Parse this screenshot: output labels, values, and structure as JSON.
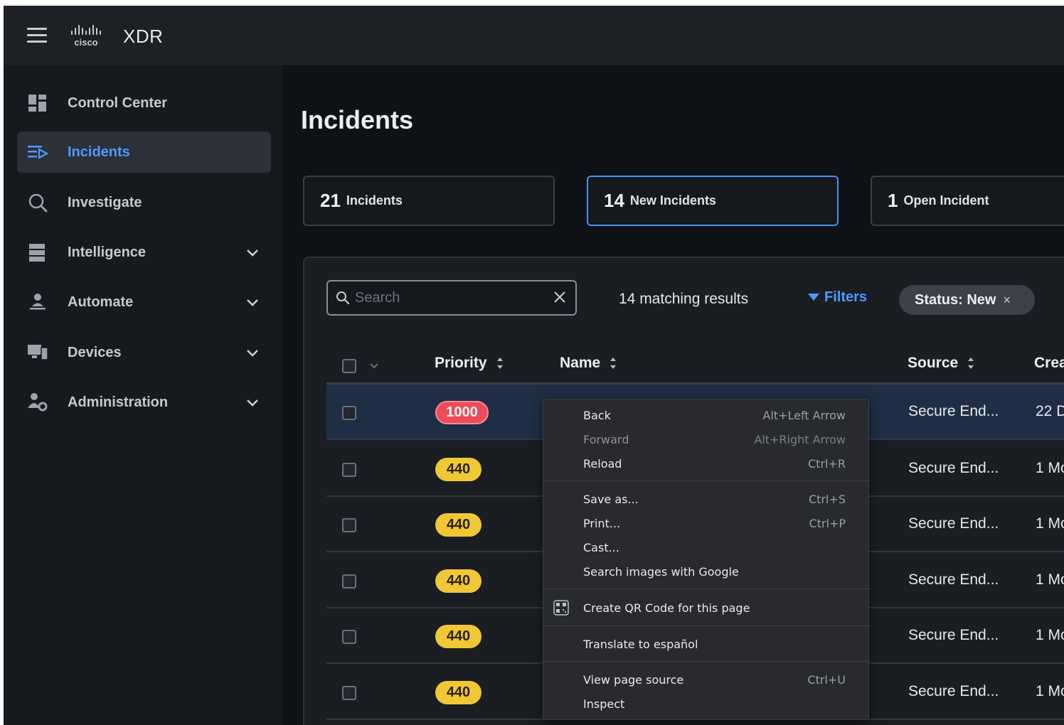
{
  "app": {
    "title": "XDR",
    "logo_text": "cisco"
  },
  "sidebar": {
    "items": [
      {
        "label": "Control Center",
        "icon": "dashboard-icon",
        "expandable": false,
        "active": false
      },
      {
        "label": "Incidents",
        "icon": "incidents-icon",
        "expandable": false,
        "active": true
      },
      {
        "label": "Investigate",
        "icon": "search-icon",
        "expandable": false,
        "active": false
      },
      {
        "label": "Intelligence",
        "icon": "database-icon",
        "expandable": true,
        "active": false
      },
      {
        "label": "Automate",
        "icon": "automation-icon",
        "expandable": true,
        "active": false
      },
      {
        "label": "Devices",
        "icon": "devices-icon",
        "expandable": true,
        "active": false
      },
      {
        "label": "Administration",
        "icon": "admin-user-icon",
        "expandable": true,
        "active": false
      }
    ]
  },
  "page": {
    "title": "Incidents",
    "stats": [
      {
        "count": "21",
        "label": "Incidents",
        "selected": false
      },
      {
        "count": "14",
        "label": "New Incidents",
        "selected": true
      },
      {
        "count": "1",
        "label": "Open Incident",
        "selected": false
      }
    ]
  },
  "toolbar": {
    "search_placeholder": "Search",
    "match_count": "14 matching results",
    "filters_label": "Filters",
    "status_chip": "Status: New",
    "chip_close": "×"
  },
  "table": {
    "columns": [
      "Priority",
      "Name",
      "Source",
      "Crea"
    ],
    "rows": [
      {
        "priority": "1000",
        "level": "red",
        "source": "Secure End...",
        "created": "22 D"
      },
      {
        "priority": "440",
        "level": "yellow",
        "source": "Secure End...",
        "created": "1 Mo"
      },
      {
        "priority": "440",
        "level": "yellow",
        "source": "Secure End...",
        "created": "1 Mo"
      },
      {
        "priority": "440",
        "level": "yellow",
        "source": "Secure End...",
        "created": "1 Mo"
      },
      {
        "priority": "440",
        "level": "yellow",
        "source": "Secure End...",
        "created": "1 Mo"
      },
      {
        "priority": "440",
        "level": "yellow",
        "source": "Secure End...",
        "created": "1 Mo"
      }
    ]
  },
  "context_menu": {
    "groups": [
      [
        {
          "label": "Back",
          "shortcut": "Alt+Left Arrow",
          "disabled": false
        },
        {
          "label": "Forward",
          "shortcut": "Alt+Right Arrow",
          "disabled": true
        },
        {
          "label": "Reload",
          "shortcut": "Ctrl+R",
          "disabled": false
        }
      ],
      [
        {
          "label": "Save as...",
          "shortcut": "Ctrl+S",
          "disabled": false
        },
        {
          "label": "Print...",
          "shortcut": "Ctrl+P",
          "disabled": false
        },
        {
          "label": "Cast...",
          "shortcut": "",
          "disabled": false
        },
        {
          "label": "Search images with Google",
          "shortcut": "",
          "disabled": false
        }
      ],
      [
        {
          "label": "Create QR Code for this page",
          "shortcut": "",
          "disabled": false,
          "icon": "qr-code-icon"
        }
      ],
      [
        {
          "label": "Translate to español",
          "shortcut": "",
          "disabled": false
        }
      ],
      [
        {
          "label": "View page source",
          "shortcut": "Ctrl+U",
          "disabled": false
        },
        {
          "label": "Inspect",
          "shortcut": "",
          "disabled": false
        }
      ]
    ]
  },
  "colors": {
    "accent_blue": "#4d9bff",
    "priority_critical": "#ee4a59",
    "priority_high": "#f0c735",
    "background": "#0e1116"
  }
}
